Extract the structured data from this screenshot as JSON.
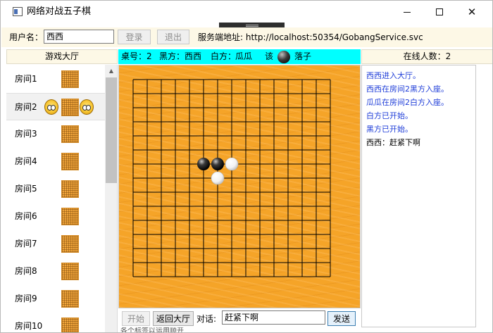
{
  "window": {
    "title": "网络对战五子棋"
  },
  "toolbar": {
    "username_label": "用户名：",
    "username_value": "西西",
    "login_label": "登录",
    "logout_label": "退出",
    "service_label": "服务端地址:",
    "service_url": "http://localhost:50354/GobangService.svc"
  },
  "lobby": {
    "header": "游戏大厅",
    "rooms": [
      {
        "name": "房间1",
        "occupied_left": false,
        "occupied_right": false
      },
      {
        "name": "房间2",
        "occupied_left": true,
        "occupied_right": true,
        "selected": true
      },
      {
        "name": "房间3",
        "occupied_left": false,
        "occupied_right": false
      },
      {
        "name": "房间4",
        "occupied_left": false,
        "occupied_right": false
      },
      {
        "name": "房间5",
        "occupied_left": false,
        "occupied_right": false
      },
      {
        "name": "房间6",
        "occupied_left": false,
        "occupied_right": false
      },
      {
        "name": "房间7",
        "occupied_left": false,
        "occupied_right": false
      },
      {
        "name": "房间8",
        "occupied_left": false,
        "occupied_right": false
      },
      {
        "name": "房间9",
        "occupied_left": false,
        "occupied_right": false
      },
      {
        "name": "房间10",
        "occupied_left": false,
        "occupied_right": false
      }
    ]
  },
  "game": {
    "table_label": "桌号：",
    "table_number": "2",
    "black_label": "黑方：",
    "black_player": "西西",
    "white_label": "白方：",
    "white_player": "瓜瓜",
    "turn_prefix": "该",
    "turn_suffix": "落子",
    "board_size": 15,
    "stones": [
      {
        "col": 5,
        "row": 6,
        "color": "black"
      },
      {
        "col": 6,
        "row": 6,
        "color": "black"
      },
      {
        "col": 7,
        "row": 6,
        "color": "white"
      },
      {
        "col": 6,
        "row": 7,
        "color": "white"
      }
    ]
  },
  "chat": {
    "start_label": "开始",
    "return_label": "返回大厅",
    "label": "对话:",
    "input_value": "赶紧下啊",
    "send_label": "发送"
  },
  "online": {
    "header": "在线人数：2"
  },
  "messages": [
    {
      "text": "西西进入大厅。",
      "type": "system"
    },
    {
      "text": "西西在房间2黑方入座。",
      "type": "system"
    },
    {
      "text": "瓜瓜在房间2白方入座。",
      "type": "system"
    },
    {
      "text": "白方已开始。",
      "type": "system"
    },
    {
      "text": "黑方已开始。",
      "type": "system"
    },
    {
      "text": "西西：赶紧下啊",
      "type": "chat"
    }
  ],
  "bottom_strip": "各个标签以运用顺开",
  "colors": {
    "status_bar": "#00ffff",
    "board_wood": "#f5a428",
    "system_message": "#1e3dd8",
    "toolbar_bg": "#fdf8e6"
  }
}
